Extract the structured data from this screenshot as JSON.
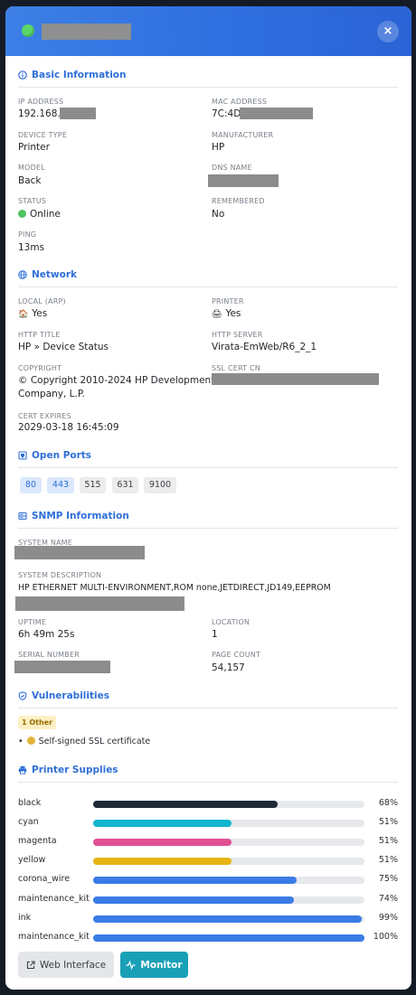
{
  "header": {
    "close_label": "×"
  },
  "sections": {
    "basic": "Basic Information",
    "network": "Network",
    "ports": "Open Ports",
    "snmp": "SNMP Information",
    "vulns": "Vulnerabilities",
    "supplies": "Printer Supplies"
  },
  "basic": {
    "ip_label": "IP ADDRESS",
    "ip_value": "192.168.",
    "mac_label": "MAC ADDRESS",
    "mac_value": "7C:4D",
    "device_type_label": "DEVICE TYPE",
    "device_type_value": "Printer",
    "manufacturer_label": "MANUFACTURER",
    "manufacturer_value": "HP",
    "model_label": "MODEL",
    "model_value": "Back",
    "dns_label": "DNS NAME",
    "status_label": "STATUS",
    "status_value": "Online",
    "remembered_label": "REMEMBERED",
    "remembered_value": "No",
    "ping_label": "PING",
    "ping_value": "13ms"
  },
  "network": {
    "local_label": "LOCAL (ARP)",
    "local_value": "Yes",
    "printer_label": "PRINTER",
    "printer_value": "Yes",
    "http_title_label": "HTTP TITLE",
    "http_title_value": "HP » Device Status",
    "http_server_label": "HTTP SERVER",
    "http_server_value": "Virata-EmWeb/R6_2_1",
    "copyright_label": "COPYRIGHT",
    "copyright_line1": "© Copyright 2010-2024 HP Development",
    "copyright_line2": "Company, L.P.",
    "ssl_label": "SSL CERT CN",
    "cert_expires_label": "CERT EXPIRES",
    "cert_expires_value": "2029-03-18 16:45:09"
  },
  "ports": [
    "80",
    "443",
    "515",
    "631",
    "9100"
  ],
  "snmp": {
    "system_name_label": "SYSTEM NAME",
    "system_desc_label": "SYSTEM DESCRIPTION",
    "system_desc_value": "HP ETHERNET MULTI-ENVIRONMENT,ROM none,JETDIRECT,JD149,EEPROM",
    "uptime_label": "UPTIME",
    "uptime_value": "6h 49m 25s",
    "location_label": "LOCATION",
    "location_value": "1",
    "serial_label": "SERIAL NUMBER",
    "page_count_label": "PAGE COUNT",
    "page_count_value": "54,157"
  },
  "vulns": {
    "badge": "1 Other",
    "items": [
      "Self-signed SSL certificate"
    ]
  },
  "supplies": [
    {
      "name": "black",
      "pct": "68%",
      "level": 68,
      "color": "#1f2937"
    },
    {
      "name": "cyan",
      "pct": "51%",
      "level": 51,
      "color": "#13b5cf"
    },
    {
      "name": "magenta",
      "pct": "51%",
      "level": 51,
      "color": "#e24f94"
    },
    {
      "name": "yellow",
      "pct": "51%",
      "level": 51,
      "color": "#e6b514"
    },
    {
      "name": "corona_wire",
      "pct": "75%",
      "level": 75,
      "color": "#3a7be6"
    },
    {
      "name": "maintenance_kit",
      "pct": "74%",
      "level": 74,
      "color": "#3a7be6"
    },
    {
      "name": "ink",
      "pct": "99%",
      "level": 99,
      "color": "#3a7be6"
    },
    {
      "name": "maintenance_kit",
      "pct": "100%",
      "level": 100,
      "color": "#3a7be6"
    }
  ],
  "buttons": {
    "web": "Web Interface",
    "monitor": "Monitor"
  }
}
